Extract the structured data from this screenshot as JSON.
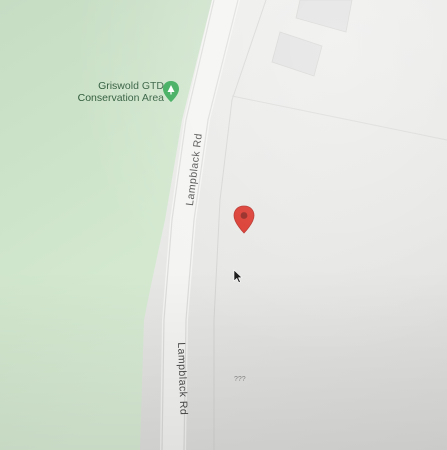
{
  "map": {
    "park": {
      "name_line1": "Griswold GTD",
      "name_line2": "Conservation Area",
      "icon": "park-pin-icon",
      "color": "#c9e3c6"
    },
    "roads": [
      {
        "name": "Lampblack Rd"
      },
      {
        "name": "Lampblack Rd"
      }
    ],
    "address_label": "???",
    "marker": {
      "icon": "red-location-pin-icon",
      "color": "#d93025"
    },
    "cursor": {
      "icon": "mouse-pointer-icon"
    }
  }
}
